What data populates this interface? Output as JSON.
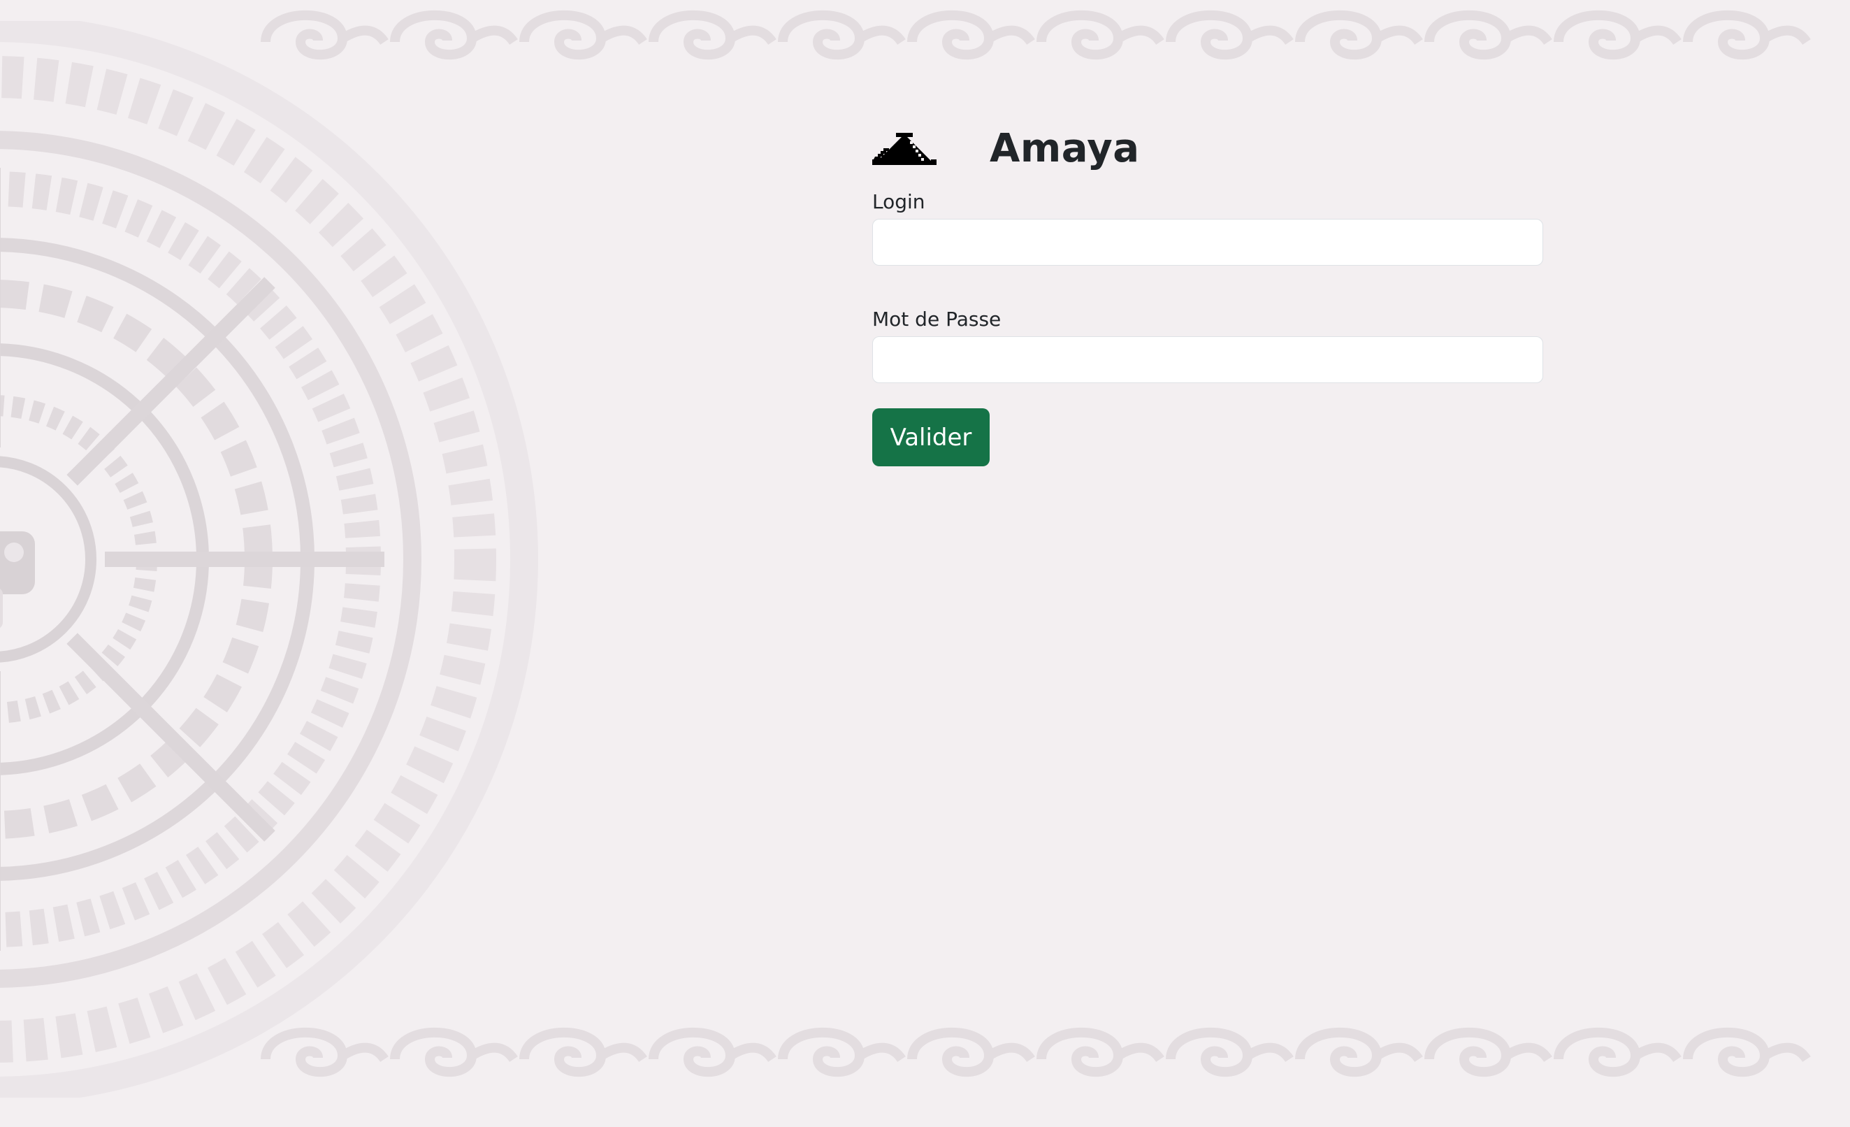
{
  "brand": {
    "name": "Amaya",
    "logo_icon": "pyramid-icon"
  },
  "form": {
    "login_label": "Login",
    "login_value": "",
    "password_label": "Mot de Passe",
    "password_value": "",
    "submit_label": "Valider"
  },
  "colors": {
    "background": "#f3eff1",
    "accent": "#157347",
    "text": "#212529",
    "ornament": "#e0dadd"
  }
}
